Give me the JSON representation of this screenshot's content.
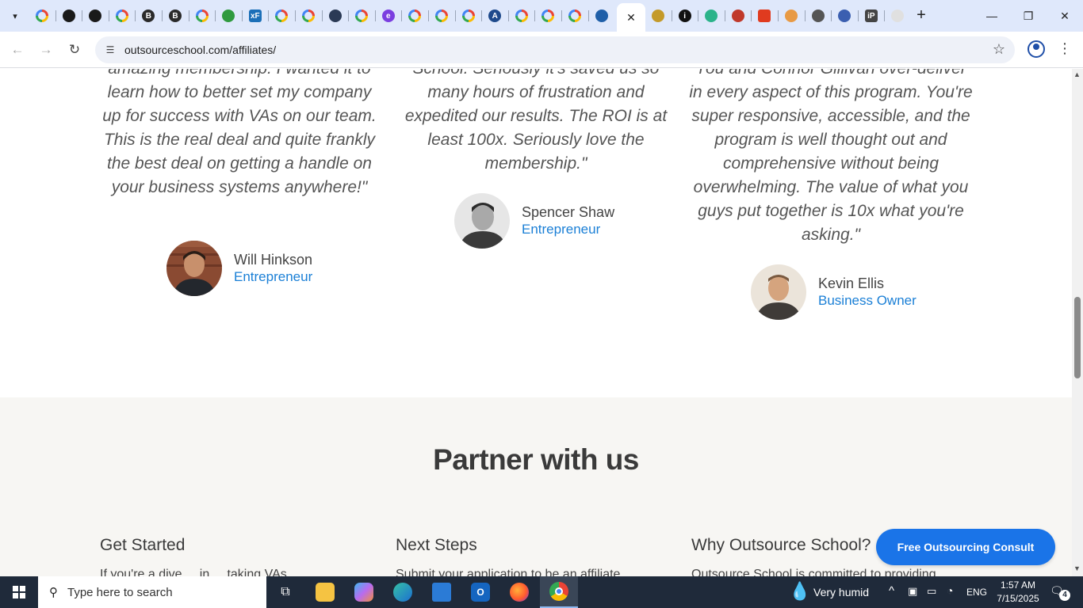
{
  "browser": {
    "tabs": [
      {
        "icon": "google-icon"
      },
      {
        "icon": "openai-icon"
      },
      {
        "icon": "openai-icon"
      },
      {
        "icon": "google-icon"
      },
      {
        "icon": "b-icon",
        "letter": "B"
      },
      {
        "icon": "b-icon",
        "letter": "B"
      },
      {
        "icon": "google-icon"
      },
      {
        "icon": "green-globe-icon"
      },
      {
        "icon": "xf-icon",
        "letter": "xF"
      },
      {
        "icon": "google-icon"
      },
      {
        "icon": "google-icon"
      },
      {
        "icon": "graduation-cap-icon"
      },
      {
        "icon": "google-icon"
      },
      {
        "icon": "e-icon",
        "letter": "e"
      },
      {
        "icon": "google-icon"
      },
      {
        "icon": "google-icon"
      },
      {
        "icon": "google-icon"
      },
      {
        "icon": "aa-icon",
        "letter": "A"
      },
      {
        "icon": "google-icon"
      },
      {
        "icon": "google-icon"
      },
      {
        "icon": "google-icon"
      },
      {
        "icon": "triangle-logo-icon"
      }
    ],
    "active_tab": {
      "icon": "close-icon"
    },
    "tabs_right": [
      {
        "icon": "crest-icon"
      },
      {
        "icon": "a-red-icon",
        "letter": "i"
      },
      {
        "icon": "wave-icon"
      },
      {
        "icon": "comic-icon"
      },
      {
        "icon": "red-square-icon"
      },
      {
        "icon": "cloud-icon"
      },
      {
        "icon": "globe-icon"
      },
      {
        "icon": "gear-icon"
      },
      {
        "icon": "ip-icon",
        "letter": "iP"
      },
      {
        "icon": "speech-icon"
      }
    ],
    "url": "outsourceschool.com/affiliates/"
  },
  "testimonials": [
    {
      "quote": "amazing membership. I wanted it to learn how to better set my company up for success with VAs on our team. This is the real deal and quite frankly the best deal on getting a handle on your business systems anywhere!\"",
      "name": "Will Hinkson",
      "role": "Entrepreneur"
    },
    {
      "quote": "School. Seriously it's saved us so many hours of frustration and expedited our results. The ROI is at least 100x. Seriously love the membership.\"",
      "name": "Spencer Shaw",
      "role": "Entrepreneur"
    },
    {
      "quote": "You and Connor Gillivan over-deliver in every aspect of this program. You're super responsive, accessible, and the program is well thought out and comprehensive without being overwhelming. The value of what you guys put together is 10x what you're asking.\"",
      "name": "Kevin Ellis",
      "role": "Business Owner"
    }
  ],
  "partner": {
    "title": "Partner with us",
    "columns": [
      {
        "title": "Get Started",
        "text": "If you're a dive ... in ... taking VAs ... "
      },
      {
        "title": "Next Steps",
        "text": "Submit your application to be an affiliate ..."
      },
      {
        "title": "Why Outsource School?",
        "text": "Outsource School is committed to providing ..."
      }
    ],
    "cta": "Free Outsourcing Consult"
  },
  "taskbar": {
    "search_placeholder": "Type here to search",
    "weather": "Very humid",
    "language": "ENG",
    "time": "1:57 AM",
    "date": "7/15/2025",
    "notifications": "4"
  }
}
